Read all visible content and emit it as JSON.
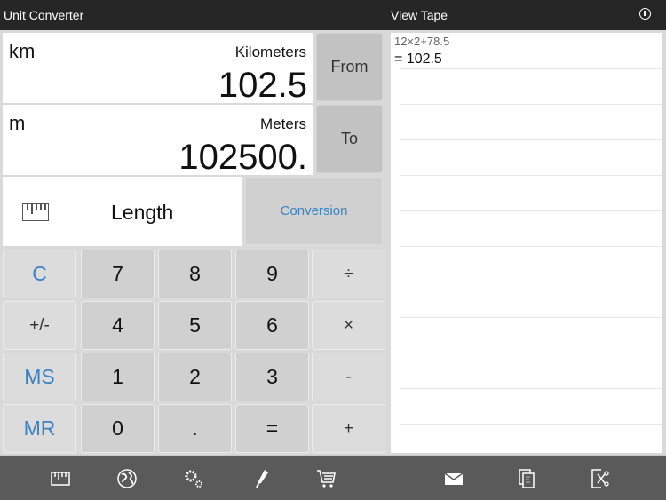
{
  "header": {
    "left_title": "Unit Converter",
    "right_title": "View Tape",
    "info_icon": "info-icon"
  },
  "converter": {
    "from": {
      "abbr": "km",
      "name": "Kilometers",
      "value": "102.5",
      "button_label": "From"
    },
    "to": {
      "abbr": "m",
      "name": "Meters",
      "value": "102500.",
      "button_label": "To"
    },
    "category": {
      "icon": "ruler-icon",
      "label": "Length"
    },
    "conversion_button_label": "Conversion"
  },
  "keypad": {
    "rows": [
      [
        "C",
        "7",
        "8",
        "9",
        "÷"
      ],
      [
        "+/-",
        "4",
        "5",
        "6",
        "×"
      ],
      [
        "MS",
        "1",
        "2",
        "3",
        "-"
      ],
      [
        "MR",
        "0",
        ".",
        "=",
        "+"
      ]
    ]
  },
  "tape": {
    "expression": "12×2+78.5",
    "result": "= 102.5"
  },
  "toolbar": {
    "left_icons": [
      "ruler-icon",
      "globe-icon",
      "gears-icon",
      "pen-icon",
      "cart-icon"
    ],
    "right_icons": [
      "mail-icon",
      "copy-icon",
      "cut-icon"
    ]
  },
  "colors": {
    "accent_blue": "#3a82c4",
    "header_bg": "#262626",
    "toolbar_bg": "#5a5a5a"
  }
}
